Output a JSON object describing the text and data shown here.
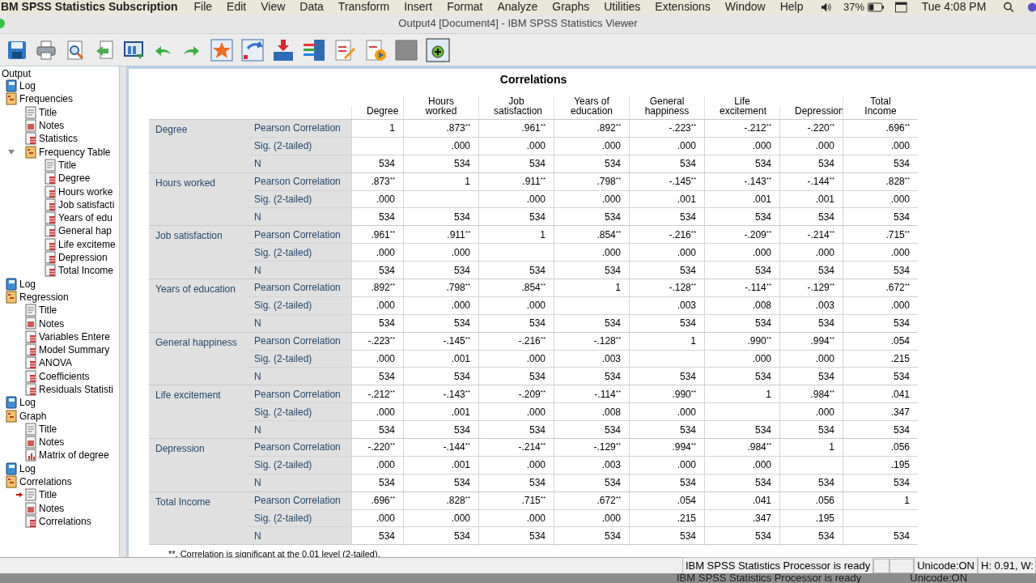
{
  "menubar": {
    "app": "IBM SPSS Statistics Subscription",
    "menus": [
      "File",
      "Edit",
      "View",
      "Data",
      "Transform",
      "Insert",
      "Format",
      "Analyze",
      "Graphs",
      "Utilities",
      "Extensions",
      "Window",
      "Help"
    ],
    "battery": "37%",
    "clock": "Tue 4:08 PM"
  },
  "window": {
    "title": "Output4 [Document4] - IBM SPSS Statistics Viewer"
  },
  "outline": {
    "label": "Output",
    "children": [
      {
        "label": "Log",
        "kind": "log"
      },
      {
        "label": "Frequencies",
        "kind": "folder",
        "children": [
          {
            "label": "Title",
            "kind": "title"
          },
          {
            "label": "Notes",
            "kind": "notes"
          },
          {
            "label": "Statistics",
            "kind": "table"
          },
          {
            "label": "Frequency Table",
            "kind": "folder",
            "expanded": true,
            "children": [
              {
                "label": "Title",
                "kind": "title"
              },
              {
                "label": "Degree",
                "kind": "table"
              },
              {
                "label": "Hours worke",
                "kind": "table"
              },
              {
                "label": "Job satisfacti",
                "kind": "table"
              },
              {
                "label": "Years of edu",
                "kind": "table"
              },
              {
                "label": "General hap",
                "kind": "table"
              },
              {
                "label": "Life exciteme",
                "kind": "table"
              },
              {
                "label": "Depression",
                "kind": "table"
              },
              {
                "label": "Total Income",
                "kind": "table"
              }
            ]
          }
        ]
      },
      {
        "label": "Log",
        "kind": "log"
      },
      {
        "label": "Regression",
        "kind": "folder",
        "children": [
          {
            "label": "Title",
            "kind": "title"
          },
          {
            "label": "Notes",
            "kind": "notes"
          },
          {
            "label": "Variables Entere",
            "kind": "table"
          },
          {
            "label": "Model Summary",
            "kind": "table"
          },
          {
            "label": "ANOVA",
            "kind": "table"
          },
          {
            "label": "Coefficients",
            "kind": "table"
          },
          {
            "label": "Residuals Statisti",
            "kind": "table"
          }
        ]
      },
      {
        "label": "Log",
        "kind": "log"
      },
      {
        "label": "Graph",
        "kind": "folder",
        "children": [
          {
            "label": "Title",
            "kind": "title"
          },
          {
            "label": "Notes",
            "kind": "notes"
          },
          {
            "label": "Matrix of degree",
            "kind": "chart"
          }
        ]
      },
      {
        "label": "Log",
        "kind": "log"
      },
      {
        "label": "Correlations",
        "kind": "folder",
        "children": [
          {
            "label": "Title",
            "kind": "title",
            "current": true
          },
          {
            "label": "Notes",
            "kind": "notes"
          },
          {
            "label": "Correlations",
            "kind": "table"
          }
        ]
      }
    ]
  },
  "table": {
    "title": "Correlations",
    "columns": [
      "Degree",
      "Hours worked",
      "Job satisfaction",
      "Years of education",
      "General happiness",
      "Life excitement",
      "Depression",
      "Total Income"
    ],
    "groups": [
      {
        "label": "Degree",
        "rows": [
          {
            "label": "Pearson Correlation",
            "cells": [
              "1",
              ".873$^{**}$",
              ".961$^{**}$",
              ".892$^{**}$",
              "-.223$^{**}$",
              "-.212$^{**}$",
              "-.220$^{**}$",
              ".696$^{**}$"
            ]
          },
          {
            "label": "Sig. (2-tailed)",
            "cells": [
              null,
              ".000",
              ".000",
              ".000",
              ".000",
              ".000",
              ".000",
              ".000"
            ]
          },
          {
            "label": "N",
            "cells": [
              "534",
              "534",
              "534",
              "534",
              "534",
              "534",
              "534",
              "534"
            ]
          }
        ]
      },
      {
        "label": "Hours worked",
        "rows": [
          {
            "label": "Pearson Correlation",
            "cells": [
              ".873$^{**}$",
              "1",
              ".911$^{**}$",
              ".798$^{**}$",
              "-.145$^{**}$",
              "-.143$^{**}$",
              "-.144$^{**}$",
              ".828$^{**}$"
            ]
          },
          {
            "label": "Sig. (2-tailed)",
            "cells": [
              ".000",
              null,
              ".000",
              ".000",
              ".001",
              ".001",
              ".001",
              ".000"
            ]
          },
          {
            "label": "N",
            "cells": [
              "534",
              "534",
              "534",
              "534",
              "534",
              "534",
              "534",
              "534"
            ]
          }
        ]
      },
      {
        "label": "Job satisfaction",
        "rows": [
          {
            "label": "Pearson Correlation",
            "cells": [
              ".961$^{**}$",
              ".911$^{**}$",
              "1",
              ".854$^{**}$",
              "-.216$^{**}$",
              "-.209$^{**}$",
              "-.214$^{**}$",
              ".715$^{**}$"
            ]
          },
          {
            "label": "Sig. (2-tailed)",
            "cells": [
              ".000",
              ".000",
              null,
              ".000",
              ".000",
              ".000",
              ".000",
              ".000"
            ]
          },
          {
            "label": "N",
            "cells": [
              "534",
              "534",
              "534",
              "534",
              "534",
              "534",
              "534",
              "534"
            ]
          }
        ]
      },
      {
        "label": "Years of education",
        "rows": [
          {
            "label": "Pearson Correlation",
            "cells": [
              ".892$^{**}$",
              ".798$^{**}$",
              ".854$^{**}$",
              "1",
              "-.128$^{**}$",
              "-.114$^{**}$",
              "-.129$^{**}$",
              ".672$^{**}$"
            ]
          },
          {
            "label": "Sig. (2-tailed)",
            "cells": [
              ".000",
              ".000",
              ".000",
              null,
              ".003",
              ".008",
              ".003",
              ".000"
            ]
          },
          {
            "label": "N",
            "cells": [
              "534",
              "534",
              "534",
              "534",
              "534",
              "534",
              "534",
              "534"
            ]
          }
        ]
      },
      {
        "label": "General happiness",
        "rows": [
          {
            "label": "Pearson Correlation",
            "cells": [
              "-.223$^{**}$",
              "-.145$^{**}$",
              "-.216$^{**}$",
              "-.128$^{**}$",
              "1",
              ".990$^{**}$",
              ".994$^{**}$",
              ".054"
            ]
          },
          {
            "label": "Sig. (2-tailed)",
            "cells": [
              ".000",
              ".001",
              ".000",
              ".003",
              null,
              ".000",
              ".000",
              ".215"
            ]
          },
          {
            "label": "N",
            "cells": [
              "534",
              "534",
              "534",
              "534",
              "534",
              "534",
              "534",
              "534"
            ]
          }
        ]
      },
      {
        "label": "Life excitement",
        "rows": [
          {
            "label": "Pearson Correlation",
            "cells": [
              "-.212$^{**}$",
              "-.143$^{**}$",
              "-.209$^{**}$",
              "-.114$^{**}$",
              ".990$^{**}$",
              "1",
              ".984$^{**}$",
              ".041"
            ]
          },
          {
            "label": "Sig. (2-tailed)",
            "cells": [
              ".000",
              ".001",
              ".000",
              ".008",
              ".000",
              null,
              ".000",
              ".347"
            ]
          },
          {
            "label": "N",
            "cells": [
              "534",
              "534",
              "534",
              "534",
              "534",
              "534",
              "534",
              "534"
            ]
          }
        ]
      },
      {
        "label": "Depression",
        "rows": [
          {
            "label": "Pearson Correlation",
            "cells": [
              "-.220$^{**}$",
              "-.144$^{**}$",
              "-.214$^{**}$",
              "-.129$^{**}$",
              ".994$^{**}$",
              ".984$^{**}$",
              "1",
              ".056"
            ]
          },
          {
            "label": "Sig. (2-tailed)",
            "cells": [
              ".000",
              ".001",
              ".000",
              ".003",
              ".000",
              ".000",
              null,
              ".195"
            ]
          },
          {
            "label": "N",
            "cells": [
              "534",
              "534",
              "534",
              "534",
              "534",
              "534",
              "534",
              "534"
            ]
          }
        ]
      },
      {
        "label": "Total Income",
        "rows": [
          {
            "label": "Pearson Correlation",
            "cells": [
              ".696$^{**}$",
              ".828$^{**}$",
              ".715$^{**}$",
              ".672$^{**}$",
              ".054",
              ".041",
              ".056",
              "1"
            ]
          },
          {
            "label": "Sig. (2-tailed)",
            "cells": [
              ".000",
              ".000",
              ".000",
              ".000",
              ".215",
              ".347",
              ".195",
              null
            ]
          },
          {
            "label": "N",
            "cells": [
              "534",
              "534",
              "534",
              "534",
              "534",
              "534",
              "534",
              "534"
            ]
          }
        ]
      }
    ],
    "footnote": "**. Correlation is significant at the 0.01 level (2-tailed)."
  },
  "status_bar": {
    "message": "IBM SPSS Statistics Processor is ready",
    "unicode": "Unicode:ON",
    "size": "H: 0.91, W:"
  },
  "background_window": {
    "message": "IBM SPSS Statistics Processor is ready",
    "unicode": "Unicode:ON"
  }
}
